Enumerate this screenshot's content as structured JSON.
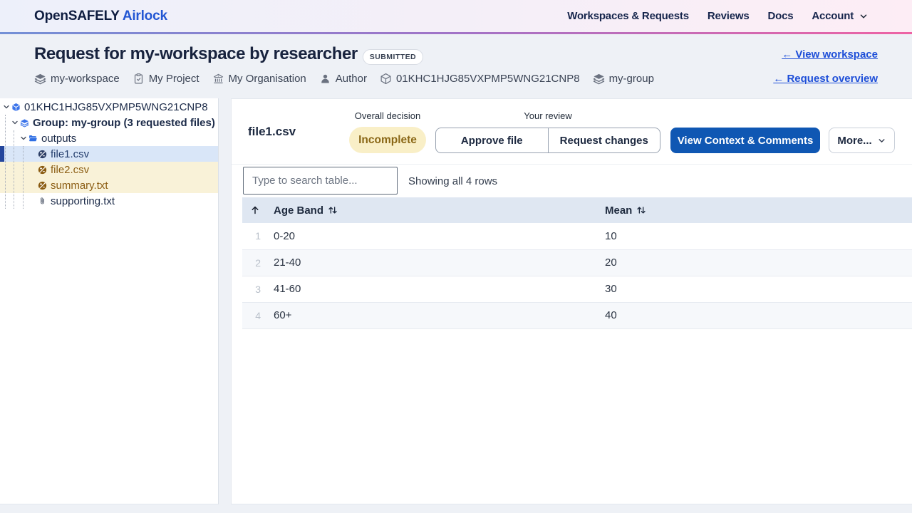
{
  "navbar": {
    "logo_part1": "OpenSAFELY",
    "logo_part2": "Airlock",
    "items": [
      {
        "label": "Workspaces & Requests"
      },
      {
        "label": "Reviews"
      },
      {
        "label": "Docs"
      },
      {
        "label": "Account",
        "has_dropdown": true
      }
    ]
  },
  "header": {
    "title": "Request for my-workspace by researcher",
    "status_badge": "SUBMITTED",
    "view_workspace_link": "← View workspace",
    "request_overview_link": "← Request overview",
    "meta": [
      {
        "icon": "layers-icon",
        "label": "my-workspace"
      },
      {
        "icon": "clipboard-check-icon",
        "label": "My Project"
      },
      {
        "icon": "building-library-icon",
        "label": "My Organisation"
      },
      {
        "icon": "user-icon",
        "label": "Author"
      },
      {
        "icon": "cube-icon",
        "label": "01KHC1HJG85VXPMP5WNG21CNP8"
      },
      {
        "icon": "layers-icon",
        "label": "my-group"
      }
    ]
  },
  "sidebar": {
    "tree": [
      {
        "label": "01KHC1HJG85VXPMP5WNG21CNP8",
        "depth": 0,
        "icon": "cube-icon",
        "expanded": true
      },
      {
        "label": "Group: my-group (3 requested files)",
        "depth": 1,
        "icon": "layers-icon",
        "expanded": true
      },
      {
        "label": "outputs",
        "depth": 2,
        "icon": "folder-open-icon",
        "expanded": true
      },
      {
        "label": "file1.csv",
        "depth": 3,
        "icon": "output-file-icon",
        "state": "selected"
      },
      {
        "label": "file2.csv",
        "depth": 3,
        "icon": "output-file-icon",
        "state": "attention"
      },
      {
        "label": "summary.txt",
        "depth": 3,
        "icon": "output-file-icon",
        "state": "attention"
      },
      {
        "label": "supporting.txt",
        "depth": 3,
        "icon": "paperclip-icon",
        "state": "default"
      }
    ]
  },
  "main": {
    "file_title": "file1.csv",
    "overall_decision": {
      "label": "Overall decision",
      "value": "Incomplete"
    },
    "review": {
      "label": "Your review",
      "approve_button": "Approve file",
      "request_changes_button": "Request changes"
    },
    "context_button": "View Context & Comments",
    "more_button": "More...",
    "search": {
      "placeholder": "Type to search table...",
      "summary": "Showing all 4 rows"
    },
    "table": {
      "columns": [
        {
          "label": "",
          "sort": "ascending"
        },
        {
          "label": "Age Band",
          "sortable": true
        },
        {
          "label": "Mean",
          "sortable": true
        }
      ],
      "rows": [
        {
          "index": "1",
          "age_band": "0-20",
          "mean": "10"
        },
        {
          "index": "2",
          "age_band": "21-40",
          "mean": "20"
        },
        {
          "index": "3",
          "age_band": "41-60",
          "mean": "30"
        },
        {
          "index": "4",
          "age_band": "60+",
          "mean": "40"
        }
      ]
    }
  },
  "colors": {
    "brand_dark": "#0e1c3f",
    "brand_blue": "#2256d3",
    "primary_button": "#0f57b3",
    "link_blue": "#1d4ed8",
    "status_incomplete_bg": "#f9efc7",
    "status_incomplete_text": "#8a6716",
    "selected_row_bg": "#d9e6f8",
    "selected_row_bar": "#23459c",
    "attention_row_bg": "#f9f2d8",
    "attention_row_text": "#8c5e14",
    "navbar_gradient": [
      "#edf0fa",
      "#fdedf5"
    ],
    "navbar_border_gradient": [
      "#7390d6",
      "#a173c7",
      "#ee63a4"
    ],
    "table_header_bg": "#dfe7f2",
    "page_bg": "#eef1f6"
  }
}
